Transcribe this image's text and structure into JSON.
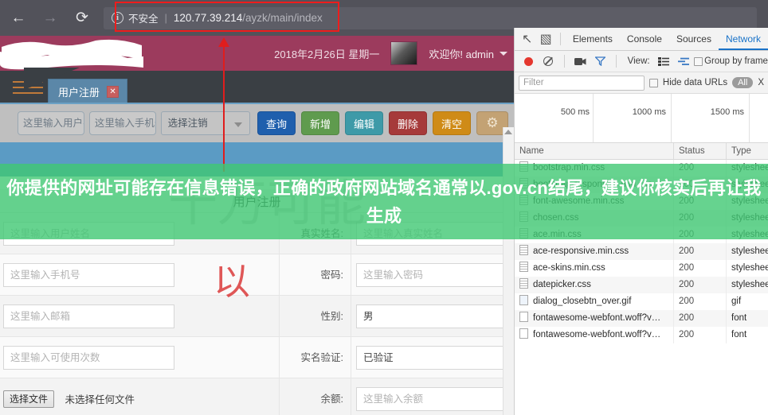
{
  "browser": {
    "back_icon": "←",
    "forward_icon": "→",
    "reload_icon": "⟳",
    "security_icon": "i",
    "security_label": "不安全",
    "separator": "|",
    "url_host": "120.77.39.214",
    "url_path": "/ayzk/main/index"
  },
  "app": {
    "header": {
      "date": "2018年2月26日 星期一",
      "welcome": "欢迎你!  admin"
    },
    "menu_label": "MENU",
    "tab": {
      "title": "用户注册",
      "close": "✕"
    },
    "toolbar": {
      "user_placeholder": "这里输入用户名",
      "phone_placeholder": "这里输入手机号",
      "select_value": "选择注销",
      "btn_query": "查询",
      "btn_add": "新增",
      "btn_edit": "编辑",
      "btn_delete": "删除",
      "btn_clear": "清空",
      "btn_gear": "⚙",
      "color_query": "#1f5fad",
      "color_add": "#5f9b4e",
      "color_edit": "#3e9aa8",
      "color_delete": "#a63a3a",
      "color_clear": "#cf8b17",
      "color_gear": "#c3a274"
    },
    "form": {
      "title": "用户注册",
      "rows": [
        {
          "input_placeholder": "这里输入用户姓名",
          "label": "真实姓名:",
          "value_placeholder": "这里输入真实姓名",
          "value_filled": false
        },
        {
          "input_placeholder": "这里输入手机号",
          "label": "密码:",
          "value_placeholder": "这里输入密码",
          "value_filled": false
        },
        {
          "input_placeholder": "这里输入邮箱",
          "label": "性别:",
          "value_placeholder": "男",
          "value_filled": true
        },
        {
          "input_placeholder": "这里输入可使用次数",
          "label": "实名验证:",
          "value_placeholder": "已验证",
          "value_filled": true
        }
      ],
      "file_row": {
        "button": "选择文件",
        "no_file": "未选择任何文件",
        "label": "余额:",
        "value_placeholder": "这里输入余额"
      }
    }
  },
  "devtools": {
    "inspect_icon": "↖",
    "device_icon": "▧",
    "tabs": [
      {
        "label": "Elements",
        "active": false
      },
      {
        "label": "Console",
        "active": false
      },
      {
        "label": "Sources",
        "active": false
      },
      {
        "label": "Network",
        "active": true
      }
    ],
    "toolbar": {
      "record_icon": "record-dot",
      "clear_icon": "no-sign",
      "camera_icon": "■",
      "filter_icon": "▽",
      "view_label": "View:",
      "list_icon": "☰",
      "waterfall_icon": "≡",
      "group_by_frame": "Group by frame"
    },
    "filterbar": {
      "filter_placeholder": "Filter",
      "hide_data_urls": "Hide data URLs",
      "all_pill": "All",
      "xhr_label": "X"
    },
    "timeline": {
      "marks": [
        "500 ms",
        "1000 ms",
        "1500 ms"
      ]
    },
    "columns": [
      "Name",
      "Status",
      "Type"
    ],
    "rows": [
      {
        "name": "bootstrap.min.css",
        "status": "200",
        "type": "stylesheet",
        "icon": "doc"
      },
      {
        "name": "bootstrap-responsive.min.css",
        "status": "200",
        "type": "stylesheet",
        "icon": "doc"
      },
      {
        "name": "font-awesome.min.css",
        "status": "200",
        "type": "stylesheet",
        "icon": "doc"
      },
      {
        "name": "chosen.css",
        "status": "200",
        "type": "stylesheet",
        "icon": "doc"
      },
      {
        "name": "ace.min.css",
        "status": "200",
        "type": "stylesheet",
        "icon": "doc"
      },
      {
        "name": "ace-responsive.min.css",
        "status": "200",
        "type": "stylesheet",
        "icon": "doc"
      },
      {
        "name": "ace-skins.min.css",
        "status": "200",
        "type": "stylesheet",
        "icon": "doc"
      },
      {
        "name": "datepicker.css",
        "status": "200",
        "type": "stylesheet",
        "icon": "doc"
      },
      {
        "name": "dialog_closebtn_over.gif",
        "status": "200",
        "type": "gif",
        "icon": "img"
      },
      {
        "name": "fontawesome-webfont.woff?v…",
        "status": "200",
        "type": "font",
        "icon": "blank"
      },
      {
        "name": "fontawesome-webfont.woff?v…",
        "status": "200",
        "type": "font",
        "icon": "blank"
      }
    ]
  },
  "annotations": {
    "overlay_text": "你提供的网址可能存在信息错误，正确的政府网站域名通常以.gov.cn结尾，建议你核实后再让我生成",
    "overlay_color": "#40c873",
    "highlight_color": "#ee1c1c",
    "ghost_watermark": "十万可能",
    "ghost_red": "以"
  }
}
